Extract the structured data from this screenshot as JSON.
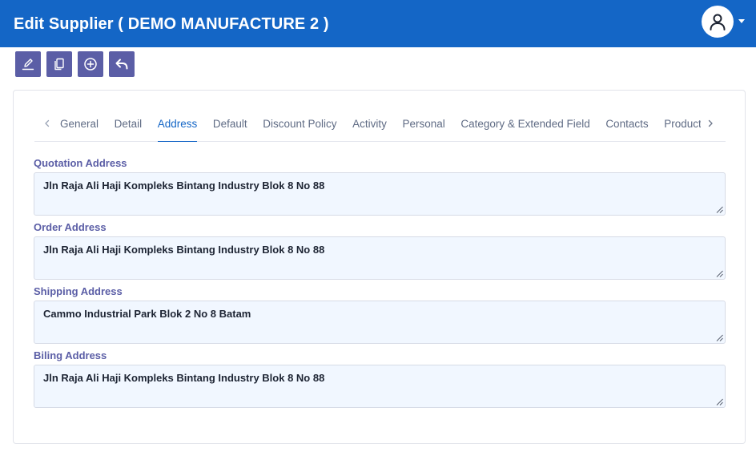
{
  "header": {
    "title": "Edit Supplier ( DEMO MANUFACTURE 2 )"
  },
  "toolbar": {
    "buttons": [
      {
        "icon": "edit-icon"
      },
      {
        "icon": "copy-icon"
      },
      {
        "icon": "add-circle-icon"
      },
      {
        "icon": "undo-icon"
      }
    ]
  },
  "tabs": {
    "items": [
      {
        "label": "General"
      },
      {
        "label": "Detail"
      },
      {
        "label": "Address"
      },
      {
        "label": "Default"
      },
      {
        "label": "Discount Policy"
      },
      {
        "label": "Activity"
      },
      {
        "label": "Personal"
      },
      {
        "label": "Category & Extended Field"
      },
      {
        "label": "Contacts"
      },
      {
        "label": "Product Category"
      }
    ],
    "active_index": 2
  },
  "address": {
    "quotation_label": "Quotation Address",
    "quotation_value": "Jln Raja Ali Haji Kompleks Bintang Industry Blok 8 No 88",
    "order_label": "Order Address",
    "order_value": "Jln Raja Ali Haji Kompleks Bintang Industry Blok 8 No 88",
    "shipping_label": "Shipping Address",
    "shipping_value": "Cammo Industrial Park Blok 2 No 8 Batam",
    "billing_label": "Biling Address",
    "billing_value": "Jln Raja Ali Haji Kompleks Bintang Industry Blok 8 No 88"
  },
  "colors": {
    "header": "#1466c6",
    "toolbar_button": "#5b5ea6",
    "label": "#5b5ea6",
    "field_background": "#f1f7ff",
    "active_tab": "#1466c6"
  }
}
